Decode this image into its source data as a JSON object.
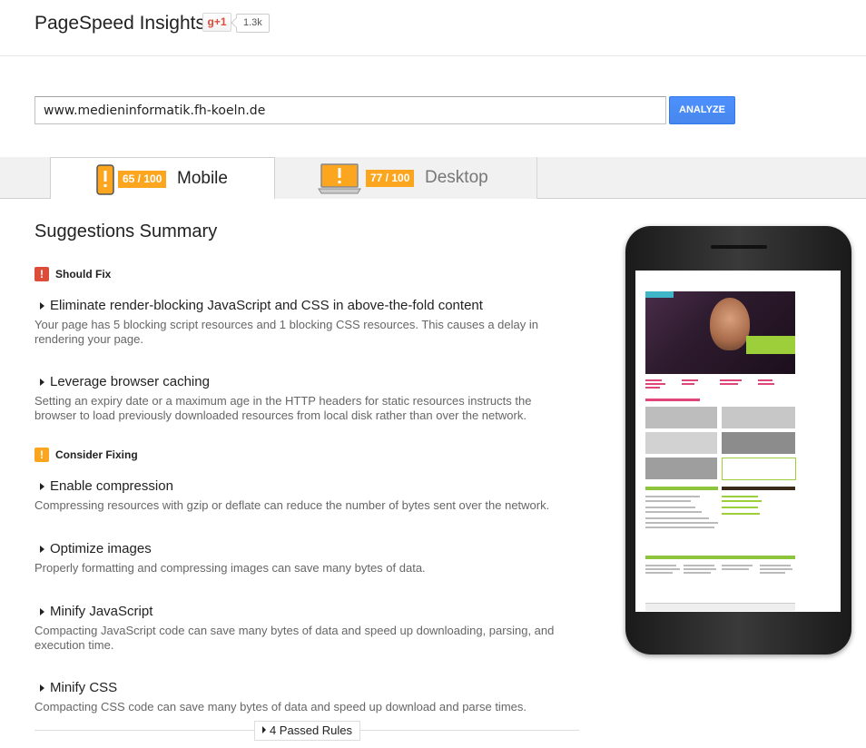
{
  "header": {
    "app_title": "PageSpeed Insights",
    "gplus_label": "g+1",
    "gplus_count": "1.3k"
  },
  "search": {
    "url_value": "www.medieninformatik.fh-koeln.de",
    "analyze_label": "ANALYZE"
  },
  "tabs": [
    {
      "label": "Mobile",
      "score": "65 / 100",
      "active": true,
      "icon": "mobile-phone-icon"
    },
    {
      "label": "Desktop",
      "score": "77 / 100",
      "active": false,
      "icon": "desktop-monitor-icon"
    }
  ],
  "summary": {
    "title": "Suggestions Summary",
    "groups": [
      {
        "label": "Should Fix",
        "icon": "exclamation-red-icon",
        "color": "#dd4b39",
        "rules": [
          {
            "title": "Eliminate render-blocking JavaScript and CSS in above-the-fold content",
            "desc": "Your page has 5 blocking script resources and 1 blocking CSS resources. This causes a delay in rendering your page."
          },
          {
            "title": "Leverage browser caching",
            "desc": "Setting an expiry date or a maximum age in the HTTP headers for static resources instructs the browser to load previously downloaded resources from local disk rather than over the network."
          }
        ]
      },
      {
        "label": "Consider Fixing",
        "icon": "exclamation-orange-icon",
        "color": "#fba61e",
        "rules": [
          {
            "title": "Enable compression",
            "desc": "Compressing resources with gzip or deflate can reduce the number of bytes sent over the network."
          },
          {
            "title": "Optimize images",
            "desc": "Properly formatting and compressing images can save many bytes of data."
          },
          {
            "title": "Minify JavaScript",
            "desc": "Compacting JavaScript code can save many bytes of data and speed up downloading, parsing, and execution time."
          },
          {
            "title": "Minify CSS",
            "desc": "Compacting CSS code can save many bytes of data and speed up download and parse times."
          }
        ]
      }
    ],
    "passed_rules_label": "4 Passed Rules"
  },
  "colors": {
    "score_badge": "#fba61e",
    "analyze_button": "#4d90fe",
    "should_fix": "#dd4b39",
    "consider_fixing": "#fba61e"
  }
}
